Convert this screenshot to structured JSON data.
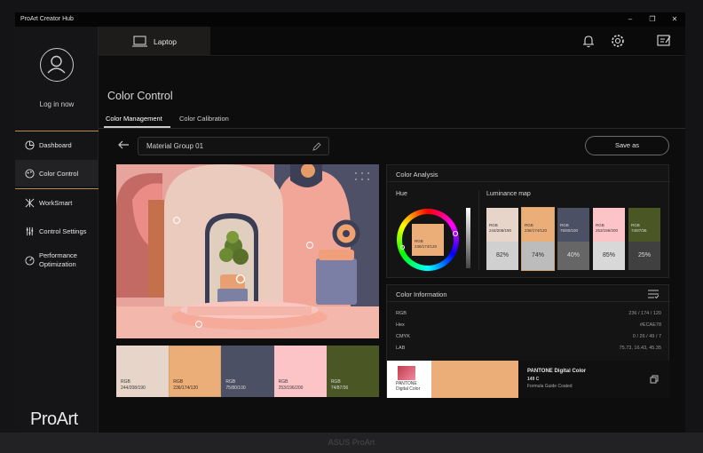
{
  "app": {
    "title": "ProArt Creator Hub",
    "bezel_label": "ASUS ProArt"
  },
  "window": {
    "min": "–",
    "max": "❐",
    "close": "✕"
  },
  "sidebar": {
    "login": "Log in now",
    "items": [
      {
        "label": "Dashboard",
        "icon": "dashboard-icon"
      },
      {
        "label": "Color Control",
        "icon": "color-control-icon"
      },
      {
        "label": "WorkSmart",
        "icon": "worksmart-icon"
      },
      {
        "label": "Control Settings",
        "icon": "control-settings-icon"
      },
      {
        "label": "Performance Optimization",
        "icon": "performance-icon"
      }
    ],
    "logo": "ProArt"
  },
  "topbar": {
    "device_tab": "Laptop"
  },
  "page": {
    "title": "Color Control",
    "tabs": [
      "Color Management",
      "Color Calibration"
    ],
    "active_tab": "Color Management",
    "material_name": "Material Group 01",
    "save_label": "Save as"
  },
  "swatches": [
    {
      "label": "RGB",
      "value": "244/208/190",
      "color": "#e6d5c8",
      "text": "#3a3a3a"
    },
    {
      "label": "RGB",
      "value": "236/174/120",
      "color": "#ecae78",
      "text": "#3a2a1a",
      "selected": true
    },
    {
      "label": "RGB",
      "value": "75/80/100",
      "color": "#4b5064",
      "text": "#dcdcdc"
    },
    {
      "label": "RGB",
      "value": "253/196/200",
      "color": "#fdc4c8",
      "text": "#3a3a3a"
    },
    {
      "label": "RGB",
      "value": "74/87/36",
      "color": "#4a5724",
      "text": "#dcdcdc"
    }
  ],
  "analysis": {
    "title": "Color Analysis",
    "hue_label": "Hue",
    "hue_center": {
      "label": "RGB",
      "value": "236/174/120"
    },
    "luminance_label": "Luminance map",
    "luminance": [
      {
        "label": "RGB",
        "value": "244/208/190",
        "percent": "82%",
        "color": "#e6d5c8",
        "gray": "#d0d0d0",
        "text": "#333"
      },
      {
        "label": "RGB",
        "value": "236/174/120",
        "percent": "74%",
        "color": "#ecae78",
        "gray": "#bcbcbc",
        "text": "#333",
        "selected": true
      },
      {
        "label": "RGB",
        "value": "75/80/100",
        "percent": "40%",
        "color": "#4b5064",
        "gray": "#666666",
        "text": "#ddd"
      },
      {
        "label": "RGB",
        "value": "253/196/200",
        "percent": "85%",
        "color": "#fdc4c8",
        "gray": "#d8d8d8",
        "text": "#333"
      },
      {
        "label": "RGB",
        "value": "74/87/36",
        "percent": "25%",
        "color": "#4a5724",
        "gray": "#404040",
        "text": "#ddd"
      }
    ]
  },
  "info": {
    "title": "Color Information",
    "rows": [
      {
        "k": "RGB",
        "v": "236 / 174 / 120"
      },
      {
        "k": "Hex",
        "v": "#ECAE78"
      },
      {
        "k": "CMYK",
        "v": "0 / 26 / 49 / 7"
      },
      {
        "k": "LAB",
        "v": "75.73, 16.43, 45.35"
      }
    ],
    "pantone": {
      "logo_line1": "PANTONE",
      "logo_line2": "Digital Color",
      "title": "PANTONE Digital Color",
      "code": "149 C",
      "guide": "Formula Guide Coated",
      "color": "#ecae78"
    }
  },
  "colors": {
    "accent": "#cfa36a",
    "panel": "#141415"
  }
}
